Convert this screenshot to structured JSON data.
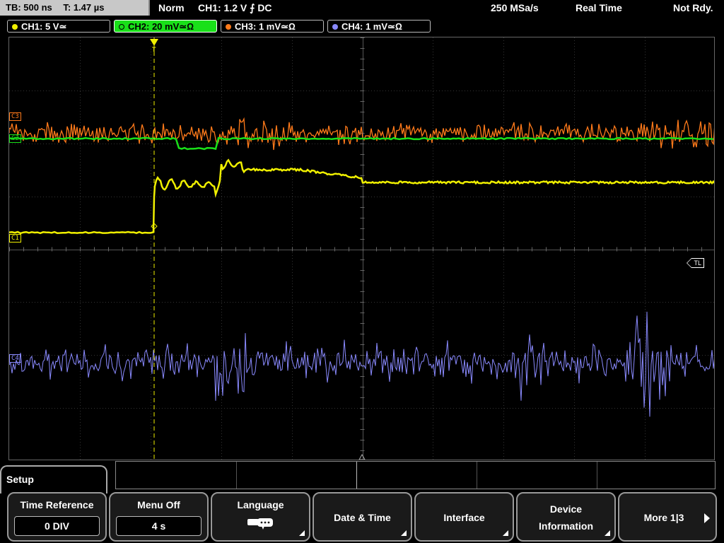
{
  "status": {
    "timebase": "TB: 500 ns",
    "trigger_time": "T: 1.47 µs",
    "mode": "Norm",
    "trigger_info": "CH1: 1.2 V ⨍ DC",
    "sample_rate": "250 MSa/s",
    "acq_mode": "Real Time",
    "state": "Not Rdy."
  },
  "channels": [
    {
      "label": "CH1: 5 V≃",
      "color": "#f0f000",
      "active": false
    },
    {
      "label": "CH2: 20 mV≃Ω",
      "color": "#19e019",
      "active": true
    },
    {
      "label": "CH3: 1 mV≃Ω",
      "color": "#ff7a1a",
      "active": false
    },
    {
      "label": "CH4: 1 mV≃Ω",
      "color": "#8a8aff",
      "active": false
    }
  ],
  "markers": {
    "c1": "C1",
    "c2": "C2",
    "c3": "C3",
    "c4": "C4",
    "trigger_level": "TL",
    "trigger_pos": "T"
  },
  "menu": {
    "title": "Setup",
    "time_reference": {
      "label": "Time Reference",
      "value": "0 DIV"
    },
    "menu_off": {
      "label": "Menu Off",
      "value": "4 s"
    },
    "language": {
      "label": "Language"
    },
    "date_time": {
      "label": "Date & Time"
    },
    "interface": {
      "label": "Interface"
    },
    "device_info": {
      "line1": "Device",
      "line2": "Information"
    },
    "more": {
      "label": "More 1|3"
    }
  }
}
